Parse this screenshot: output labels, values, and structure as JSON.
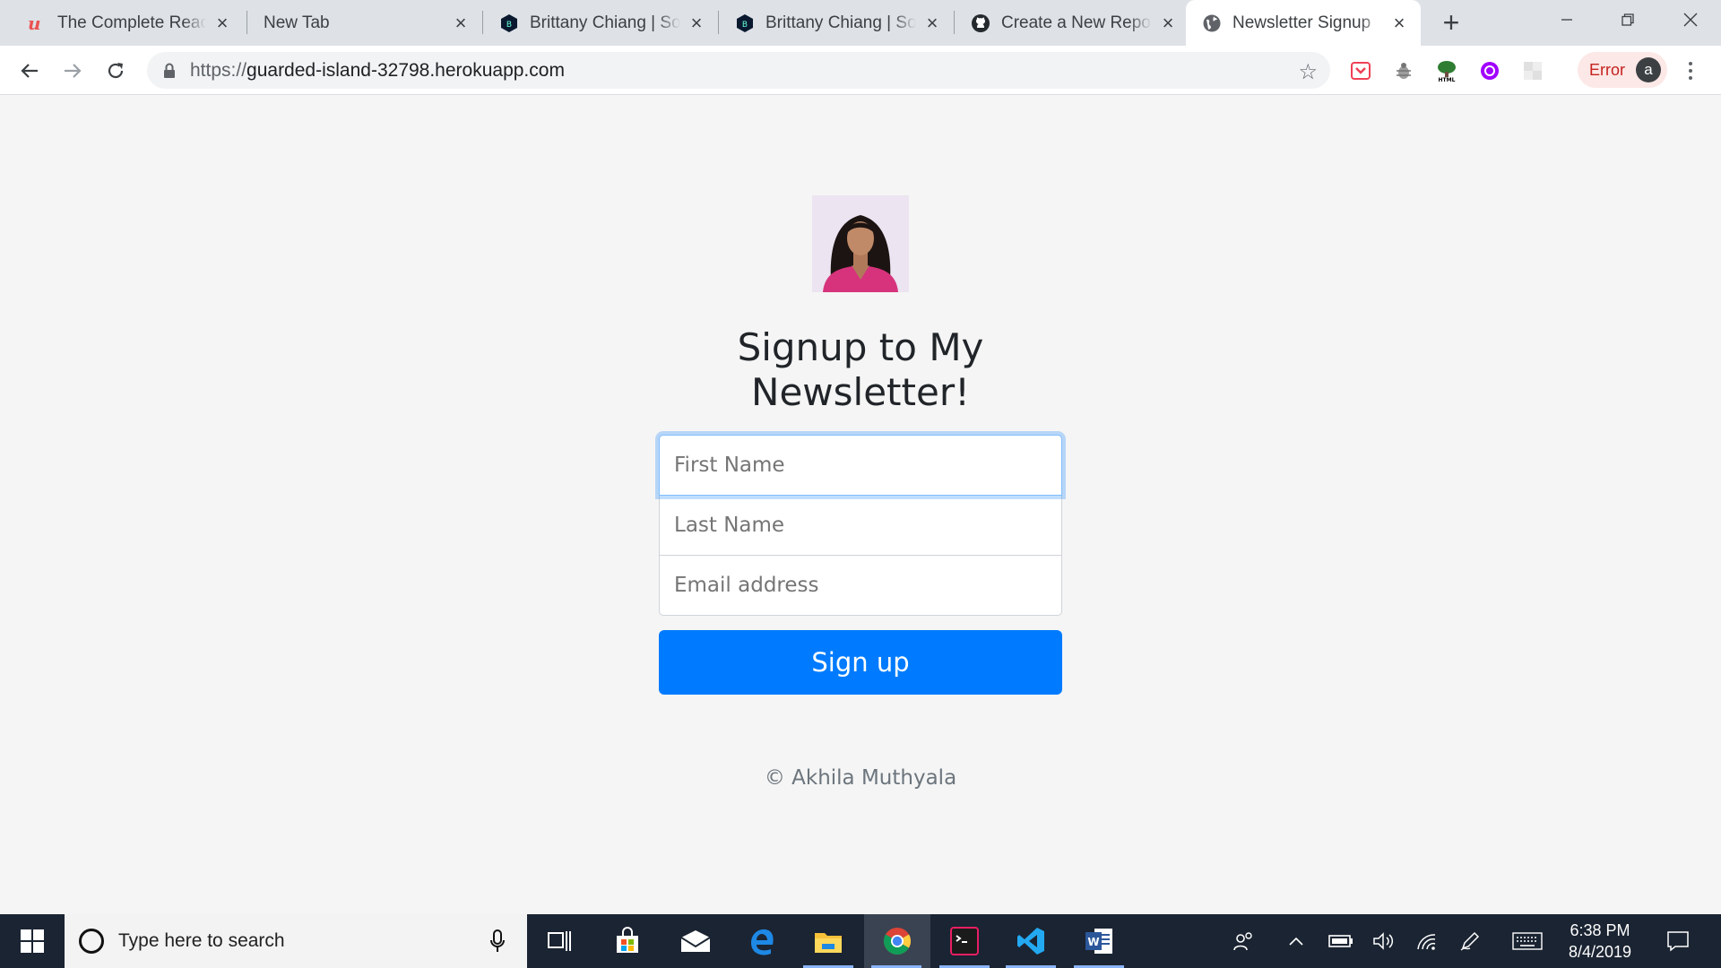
{
  "browser": {
    "tabs": [
      {
        "title": "The Complete React",
        "favicon": "udemy-icon",
        "active": false
      },
      {
        "title": "New Tab",
        "favicon": "",
        "active": false
      },
      {
        "title": "Brittany Chiang | Soft",
        "favicon": "brittany-logo-icon",
        "active": false
      },
      {
        "title": "Brittany Chiang | Soft",
        "favicon": "brittany-logo-icon",
        "active": false
      },
      {
        "title": "Create a New Reposi",
        "favicon": "github-icon",
        "active": false
      },
      {
        "title": "Newsletter Signup",
        "favicon": "globe-icon",
        "active": true
      }
    ],
    "url_scheme": "https://",
    "url_host": "guarded-island-32798.herokuapp.com",
    "profile_status": "Error",
    "profile_initial": "a"
  },
  "page": {
    "heading": "Signup to My Newsletter!",
    "form": {
      "first_name_placeholder": "First Name",
      "last_name_placeholder": "Last Name",
      "email_placeholder": "Email address",
      "submit_label": "Sign up"
    },
    "footer": "© Akhila Muthyala",
    "accent_color": "#007bff"
  },
  "taskbar": {
    "search_placeholder": "Type here to search",
    "time": "6:38 PM",
    "date": "8/4/2019"
  }
}
